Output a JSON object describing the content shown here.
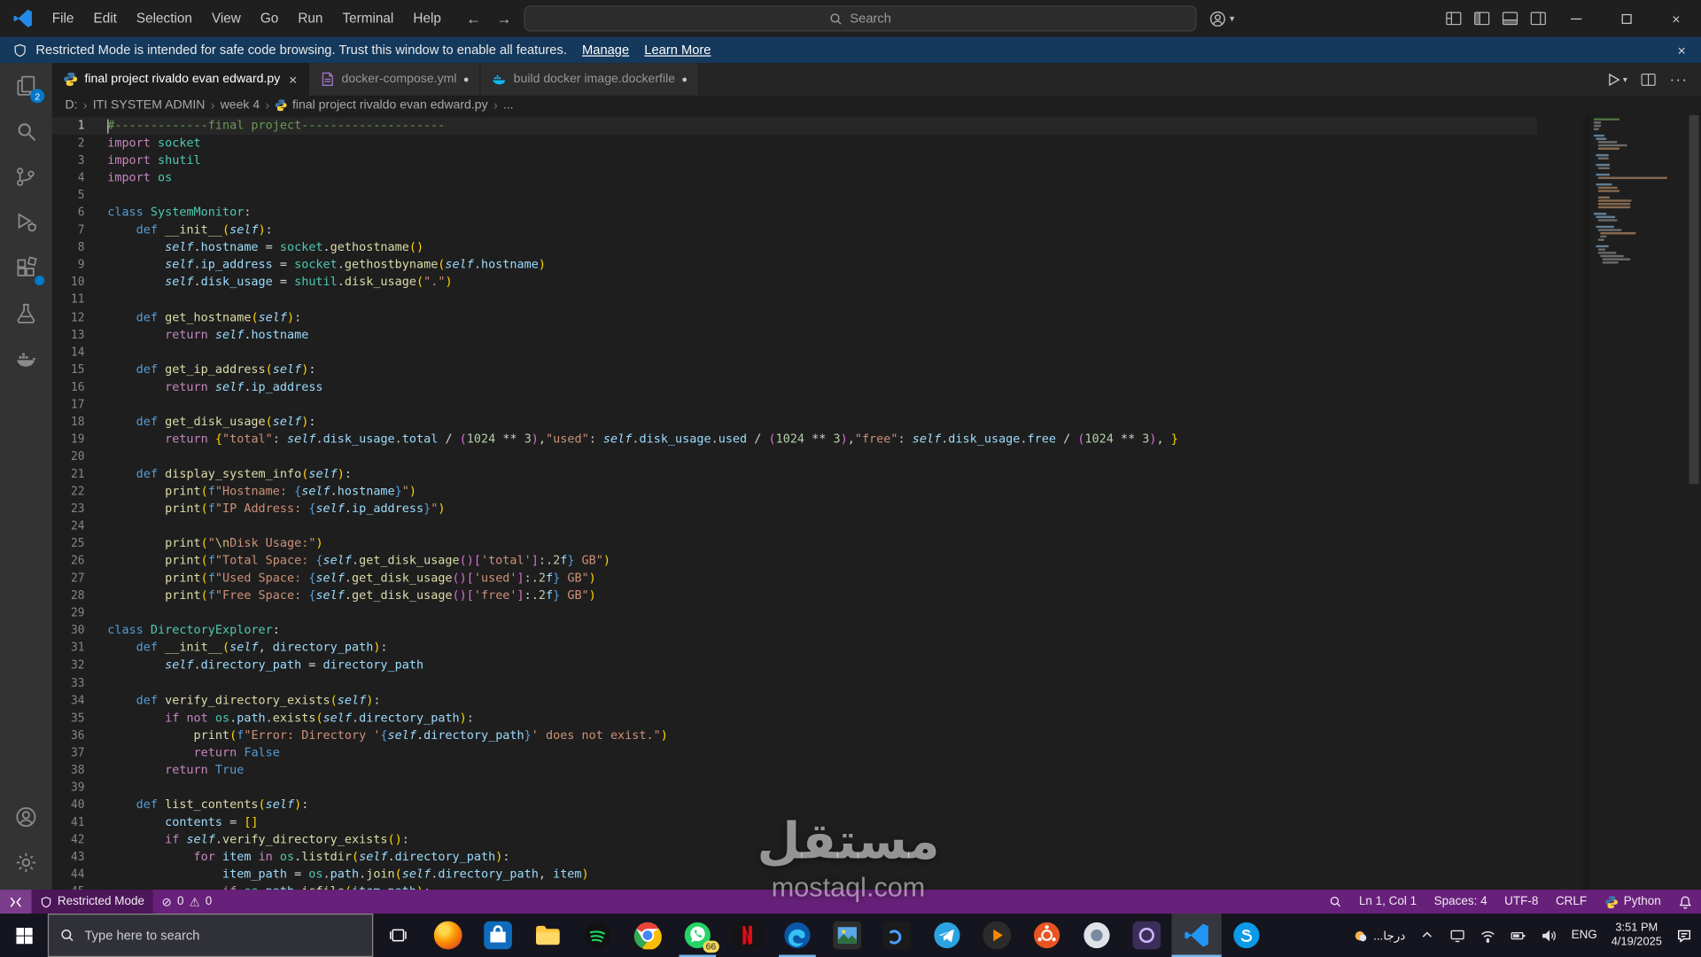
{
  "titlebar": {
    "menus": [
      "File",
      "Edit",
      "Selection",
      "View",
      "Go",
      "Run",
      "Terminal",
      "Help"
    ],
    "search_placeholder": "Search"
  },
  "banner": {
    "text": "Restricted Mode is intended for safe code browsing. Trust this window to enable all features.",
    "links": [
      "Manage",
      "Learn More"
    ]
  },
  "activity_bar": {
    "items": [
      {
        "icon": "files",
        "name": "explorer",
        "badge": "2"
      },
      {
        "icon": "search",
        "name": "search"
      },
      {
        "icon": "source-control",
        "name": "source-control"
      },
      {
        "icon": "run-debug",
        "name": "run-and-debug"
      },
      {
        "icon": "extensions",
        "name": "extensions",
        "badge": "dot"
      },
      {
        "icon": "testing",
        "name": "testing"
      },
      {
        "icon": "docker",
        "name": "docker"
      }
    ],
    "bottom": [
      {
        "icon": "account",
        "name": "accounts"
      },
      {
        "icon": "gear",
        "name": "manage"
      }
    ]
  },
  "tabs": [
    {
      "label": "final project rivaldo evan edward.py",
      "icon": "python",
      "active": true,
      "dirty": false
    },
    {
      "label": "docker-compose.yml",
      "icon": "yaml",
      "active": false,
      "dirty": true
    },
    {
      "label": "build docker image.dockerfile",
      "icon": "docker",
      "active": false,
      "dirty": true
    }
  ],
  "breadcrumbs": [
    "D:",
    "ITI SYSTEM ADMIN",
    "week 4",
    "final project rivaldo evan edward.py",
    "..."
  ],
  "editor": {
    "language": "python",
    "cursor_text": "Ln 1, Col 1",
    "lines": [
      "#-------------final project--------------------",
      "import socket",
      "import shutil",
      "import os",
      "",
      "class SystemMonitor:",
      "    def __init__(self):",
      "        self.hostname = socket.gethostname()",
      "        self.ip_address = socket.gethostbyname(self.hostname)",
      "        self.disk_usage = shutil.disk_usage(\".\")",
      "",
      "    def get_hostname(self):",
      "        return self.hostname",
      "",
      "    def get_ip_address(self):",
      "        return self.ip_address",
      "",
      "    def get_disk_usage(self):",
      "        return {\"total\": self.disk_usage.total / (1024 ** 3),\"used\": self.disk_usage.used / (1024 ** 3),\"free\": self.disk_usage.free / (1024 ** 3), }",
      "",
      "    def display_system_info(self):",
      "        print(f\"Hostname: {self.hostname}\")",
      "        print(f\"IP Address: {self.ip_address}\")",
      "",
      "        print(\"\\nDisk Usage:\")",
      "        print(f\"Total Space: {self.get_disk_usage()['total']:.2f} GB\")",
      "        print(f\"Used Space: {self.get_disk_usage()['used']:.2f} GB\")",
      "        print(f\"Free Space: {self.get_disk_usage()['free']:.2f} GB\")",
      "",
      "class DirectoryExplorer:",
      "    def __init__(self, directory_path):",
      "        self.directory_path = directory_path",
      "",
      "    def verify_directory_exists(self):",
      "        if not os.path.exists(self.directory_path):",
      "            print(f\"Error: Directory '{self.directory_path}' does not exist.\")",
      "            return False",
      "        return True",
      "",
      "    def list_contents(self):",
      "        contents = []",
      "        if self.verify_directory_exists():",
      "            for item in os.listdir(self.directory_path):",
      "                item_path = os.path.join(self.directory_path, item)",
      "                if os.path.isfile(item_path):"
    ]
  },
  "status_bar": {
    "restricted_label": "Restricted Mode",
    "errors": "0",
    "warnings": "0",
    "items_right": [
      {
        "name": "cursor-position",
        "label": "Ln 1, Col 1"
      },
      {
        "name": "indentation",
        "label": "Spaces: 4"
      },
      {
        "name": "encoding",
        "label": "UTF-8"
      },
      {
        "name": "eol",
        "label": "CRLF"
      },
      {
        "name": "language-mode",
        "label": "Python"
      }
    ]
  },
  "taskbar": {
    "search_placeholder": "Type here to search",
    "apps": [
      {
        "name": "firefox"
      },
      {
        "name": "microsoft-store"
      },
      {
        "name": "file-explorer"
      },
      {
        "name": "spotify"
      },
      {
        "name": "chrome"
      },
      {
        "name": "whatsapp",
        "badge": "66",
        "running": true
      },
      {
        "name": "netflix"
      },
      {
        "name": "edge",
        "running": true
      },
      {
        "name": "photos"
      },
      {
        "name": "dev-tool"
      },
      {
        "name": "telegram"
      },
      {
        "name": "media-player"
      },
      {
        "name": "ubuntu"
      },
      {
        "name": "light-app"
      },
      {
        "name": "screen-capture"
      },
      {
        "name": "vscode",
        "running": true,
        "focused": true
      },
      {
        "name": "messenger-blue"
      }
    ],
    "tray": {
      "widget_label": "...درجا",
      "language_label": "ENG",
      "time": "3:51 PM",
      "date": "4/19/2025"
    }
  },
  "watermark": {
    "title": "مستقل",
    "subtitle": "mostaql.com"
  }
}
